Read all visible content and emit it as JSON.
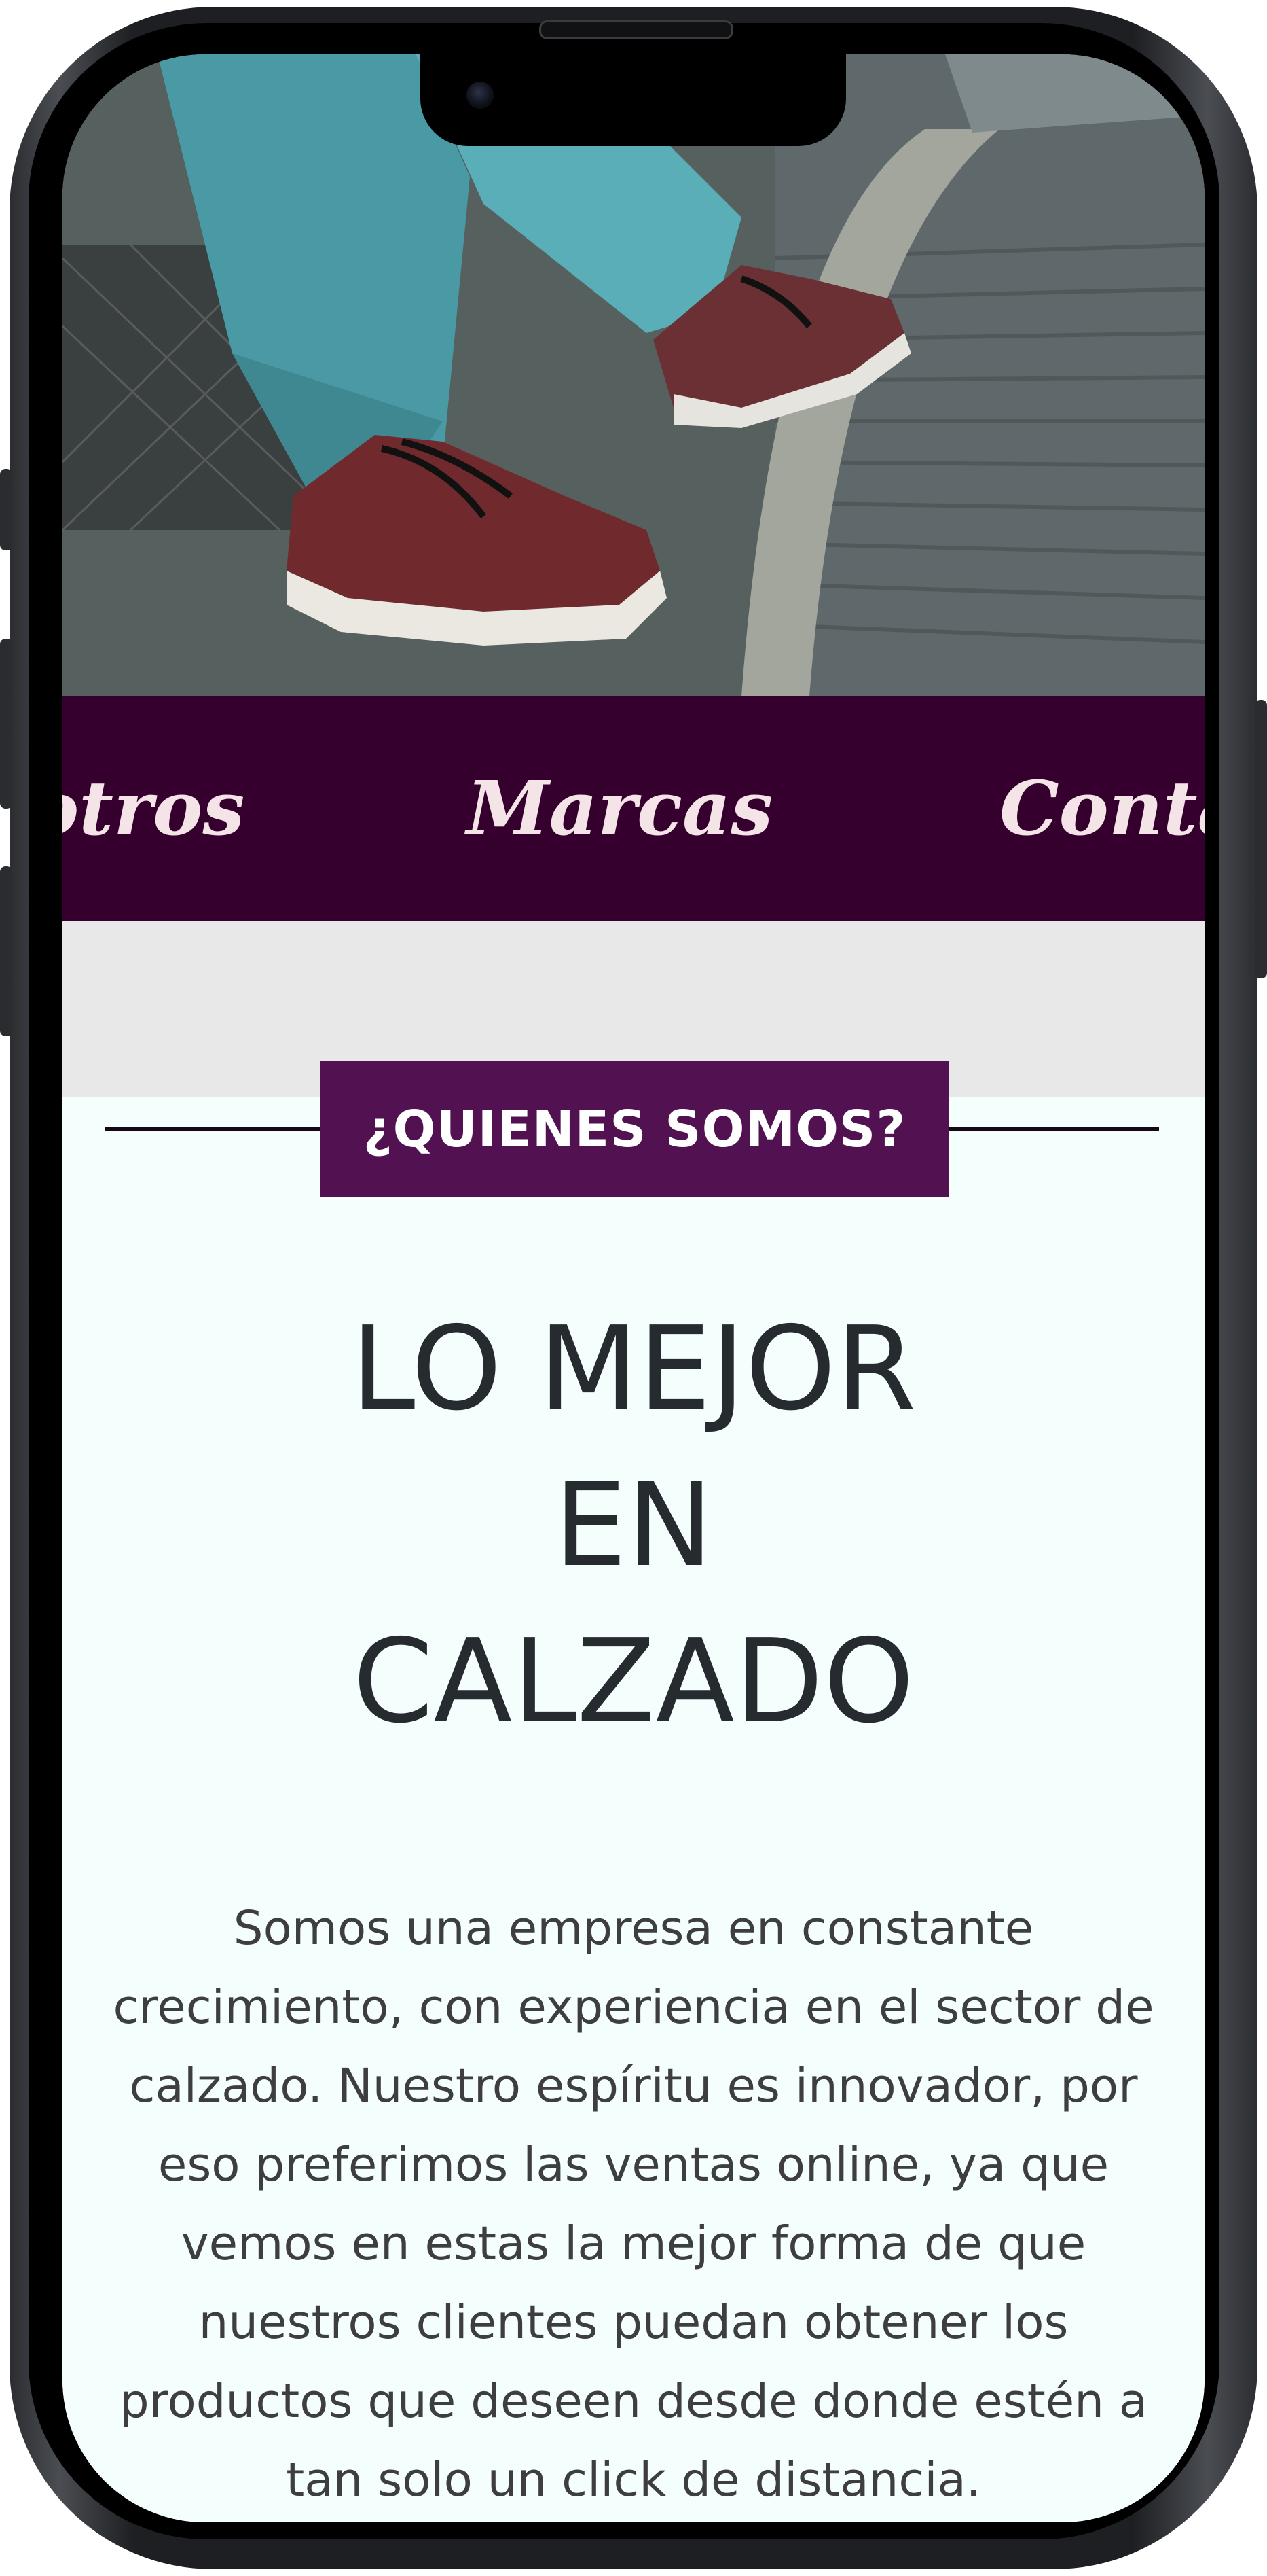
{
  "nav": {
    "items": [
      {
        "label": "Nosotros"
      },
      {
        "label": "Marcas"
      },
      {
        "label": "Contacto"
      }
    ]
  },
  "about": {
    "section_label": "¿QUIENES SOMOS?",
    "headline_lines": [
      "LO MEJOR",
      "EN",
      "CALZADO"
    ],
    "description": "Somos una empresa en constante crecimiento, con experiencia en el sector de calzado. Nuestro espíritu es innovador, por eso preferimos las ventas online, ya que vemos en estas la mejor forma de que nuestros clientes puedan obtener los productos que deseen desde donde estén a tan solo un click de distancia."
  },
  "colors": {
    "nav_background": "#35002d",
    "section_tag_background": "#521252",
    "content_background": "#f3fefd"
  }
}
